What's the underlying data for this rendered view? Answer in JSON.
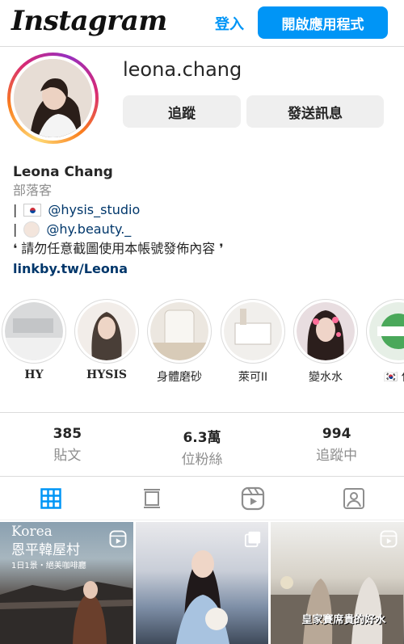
{
  "header": {
    "logo": "Instagram",
    "login_label": "登入",
    "open_app_label": "開啟應用程式",
    "accent": "#0095f6"
  },
  "profile": {
    "username": "leona.chang",
    "follow_label": "追蹤",
    "message_label": "發送訊息"
  },
  "bio": {
    "name": "Leona Chang",
    "category": "部落客",
    "lines": [
      {
        "prefix": "|",
        "emoji": "south-korea-flag",
        "handle": "@hysis_studio"
      },
      {
        "prefix": "|",
        "emoji": "face-mask-emoji",
        "handle": "@hy.beauty._"
      }
    ],
    "notice": "❛ 請勿任意截圖使用本帳號發佈內容 ❜",
    "link": "linkby.tw/Leona"
  },
  "highlights": [
    {
      "label": "HY",
      "icon": "highlight-hy"
    },
    {
      "label": "HYSIS",
      "icon": "highlight-hysis"
    },
    {
      "label": "身體磨砂",
      "icon": "highlight-body-scrub"
    },
    {
      "label": "萊可II",
      "icon": "highlight-laike"
    },
    {
      "label": "變水水",
      "icon": "highlight-water"
    },
    {
      "label": "🇰🇷 保",
      "icon": "highlight-korea"
    }
  ],
  "stats": [
    {
      "value": "385",
      "label": "貼文"
    },
    {
      "value": "6.3萬",
      "label": "位粉絲"
    },
    {
      "value": "994",
      "label": "追蹤中"
    }
  ],
  "tabs": [
    {
      "name": "posts-grid-icon",
      "active": true
    },
    {
      "name": "feed-icon",
      "active": false
    },
    {
      "name": "reels-icon",
      "active": false
    },
    {
      "name": "tagged-icon",
      "active": false
    }
  ],
  "posts": [
    {
      "overlay_icon": "reels-icon",
      "text_1": "Korea",
      "text_2": "恩平韓屋村",
      "text_3": "1日1景・絕美咖啡廳"
    },
    {
      "overlay_icon": "carousel-icon"
    },
    {
      "overlay_icon": "reels-icon",
      "text_4": "皇家賽席貴的好水"
    }
  ]
}
